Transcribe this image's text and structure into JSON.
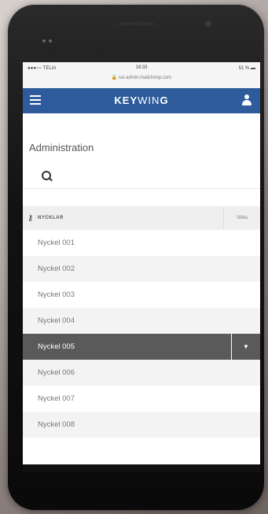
{
  "status_bar": {
    "carrier": "TELIA",
    "time": "19:33",
    "battery": "51 %",
    "url": "ssl.admin.mailchimp.com"
  },
  "header": {
    "logo_bold": "KEY",
    "logo_light": "WIN",
    "logo_end": "G"
  },
  "page": {
    "title": "Administration"
  },
  "section": {
    "label": "NYCKLAR",
    "search_label": "Sökа"
  },
  "keys": [
    {
      "label": "Nyckel 001"
    },
    {
      "label": "Nyckel 002"
    },
    {
      "label": "Nyckel 003"
    },
    {
      "label": "Nyckel 004"
    },
    {
      "label": "Nyckel 005"
    },
    {
      "label": "Nyckel 006"
    },
    {
      "label": "Nyckel 007"
    },
    {
      "label": "Nyckel 008"
    }
  ],
  "colors": {
    "header_bg": "#2d5b9c",
    "selected_row": "#5a5a5a"
  }
}
